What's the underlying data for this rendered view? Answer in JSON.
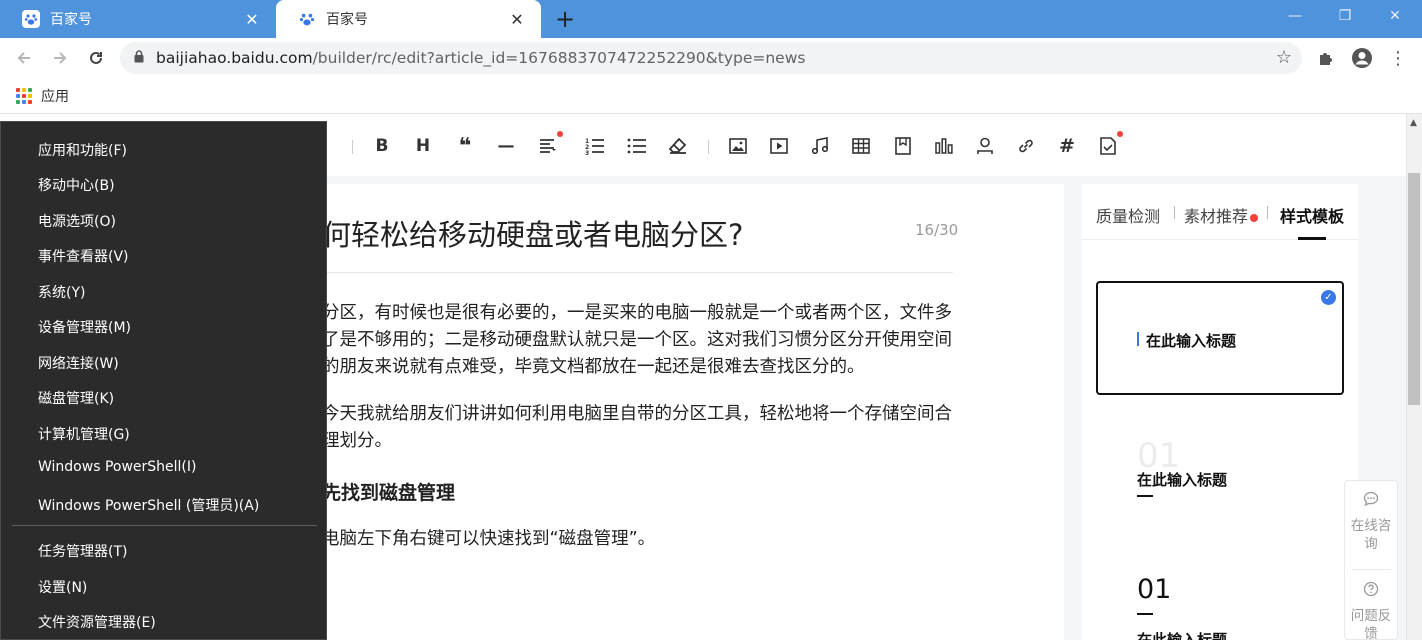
{
  "browser": {
    "tabs": [
      {
        "title": "百家号",
        "close": "✕"
      },
      {
        "title": "百家号",
        "close": "✕"
      }
    ],
    "new_tab": "+",
    "window_controls": {
      "minimize": "—",
      "restore": "❐",
      "close": "✕"
    },
    "url_host": "baijiahao.baidu.com",
    "url_path": "/builder/rc/edit?article_id=1676883707472252290&type=news",
    "bookmarks": {
      "apps_label": "应用"
    }
  },
  "editor": {
    "title": "何轻松给移动硬盘或者电脑分区?",
    "title_counter": "16/30",
    "paragraphs": [
      "分区，有时候也是很有必要的，一是买来的电脑一般就是一个或者两个区，文件多了是不够用的；二是移动硬盘默认就只是一个区。这对我们习惯分区分开使用空间的朋友来说就有点难受，毕竟文档都放在一起还是很难去查找区分的。",
      "今天我就给朋友们讲讲如何利用电脑里自带的分区工具，轻松地将一个存储空间合理划分。"
    ],
    "heading": "先找到磁盘管理",
    "paragraph3": "电脑左下角右键可以快速找到“磁盘管理”。",
    "toolbar": {
      "bold": "B",
      "heading": "H",
      "quote": "❝",
      "divider": "—",
      "hashtag": "#"
    }
  },
  "panel": {
    "tabs": [
      "质量检测",
      "素材推荐",
      "样式模板"
    ],
    "template1_title": "在此输入标题",
    "template2_ghost_number": "01",
    "template2_title": "在此输入标题",
    "template3_number": "01",
    "template3_title": "在此输入标题"
  },
  "float_bar": {
    "consult_label": "在线咨询",
    "feedback_label": "问题反馈"
  },
  "winx_menu": {
    "items_top": [
      "应用和功能(F)",
      "移动中心(B)",
      "电源选项(O)",
      "事件查看器(V)",
      "系统(Y)",
      "设备管理器(M)",
      "网络连接(W)",
      "磁盘管理(K)",
      "计算机管理(G)",
      "Windows PowerShell(I)",
      "Windows PowerShell (管理员)(A)"
    ],
    "items_bottom": [
      "任务管理器(T)",
      "设置(N)",
      "文件资源管理器(E)"
    ]
  },
  "colors": {
    "tab_strip": "#4f93dd",
    "accent_blue": "#3a77e9",
    "badge_red": "#f3403c",
    "menu_bg": "#2b2b2b"
  }
}
